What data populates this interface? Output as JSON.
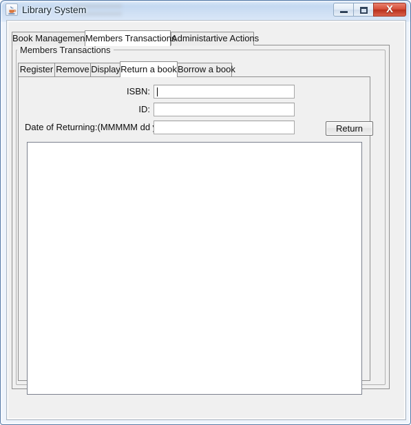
{
  "window": {
    "title": "Library System",
    "icon": "java-coffee-cup-icon",
    "controls": {
      "minimize_label": "",
      "maximize_label": "",
      "close_label": "X"
    }
  },
  "outer_tabs": {
    "items": [
      {
        "label": "Book Management",
        "selected": false
      },
      {
        "label": "Members Transactions",
        "selected": true
      },
      {
        "label": "Administartive Actions",
        "selected": false
      }
    ]
  },
  "group": {
    "title": "Members Transactions"
  },
  "inner_tabs": {
    "items": [
      {
        "label": "Register",
        "selected": false
      },
      {
        "label": "Remove",
        "selected": false
      },
      {
        "label": "Display",
        "selected": false
      },
      {
        "label": "Return a book",
        "selected": true
      },
      {
        "label": "Borrow a book",
        "selected": false
      }
    ]
  },
  "form": {
    "isbn": {
      "label": "ISBN:",
      "value": "",
      "placeholder": ""
    },
    "id": {
      "label": "ID:",
      "value": "",
      "placeholder": ""
    },
    "date": {
      "label": "Date of Returning:(MMMMM dd yyyy)",
      "value": "",
      "placeholder": ""
    },
    "return_button": "Return"
  },
  "output": {
    "text": ""
  },
  "colors": {
    "panel_background": "#f0f0f0",
    "selected_tab": "#ffffff",
    "unselected_tab": "#ececec",
    "border": "#8e8e8e",
    "titlebar_start": "#d9e7f7",
    "titlebar_end": "#eef4fc",
    "close_button": "#c0392b",
    "field_background": "#ffffff"
  }
}
